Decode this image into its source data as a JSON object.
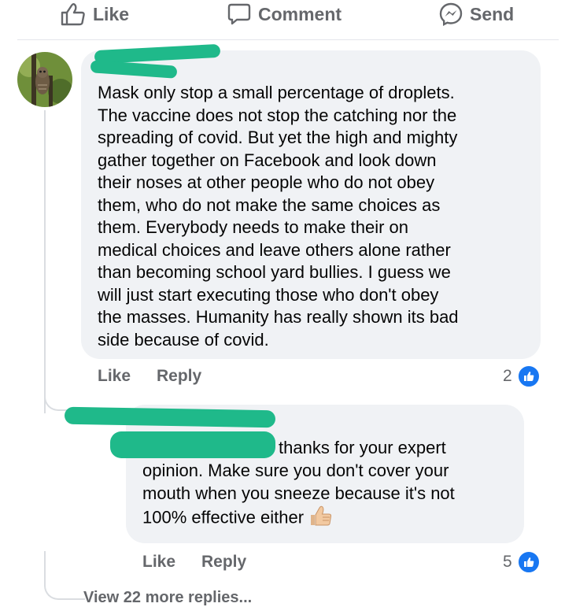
{
  "actions": {
    "like": "Like",
    "comment": "Comment",
    "send": "Send"
  },
  "comments": [
    {
      "text": "Mask only stop a small percentage of droplets.\nThe vaccine does not stop the catching nor the\nspreading of covid. But yet the high and mighty\ngather together on Facebook and look down\ntheir noses at other people who do not obey\nthem, who do not make the same choices as\nthem. Everybody needs to make their on\nmedical choices and leave others alone rather\nthan becoming school yard bullies. I guess we\nwill just start executing those who don't obey\nthe masses.  Humanity has really shown its bad\nside because of covid.",
      "like_label": "Like",
      "reply_label": "Reply",
      "reaction_count": "2"
    },
    {
      "text_first_line": "thanks for your expert",
      "text_rest": "opinion. Make sure you don't cover your\nmouth when you sneeze because it's not\n100% effective either",
      "emoji": "thumbs-up-icon",
      "like_label": "Like",
      "reply_label": "Reply",
      "reaction_count": "5"
    }
  ],
  "view_more": "View 22 more replies...",
  "colors": {
    "bubble": "#f0f2f5",
    "muted_text": "#65676b",
    "like_blue": "#1877f2",
    "redaction": "#1fb98a"
  }
}
